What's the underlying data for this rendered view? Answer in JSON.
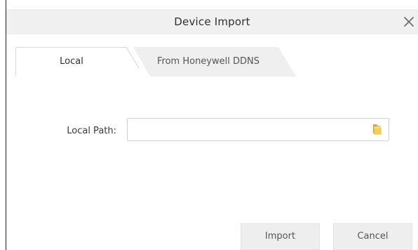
{
  "dialog": {
    "title": "Device Import",
    "close_icon": "close-icon"
  },
  "tabs": [
    {
      "label": "Local",
      "active": true
    },
    {
      "label": "From Honeywell DDNS",
      "active": false
    }
  ],
  "form": {
    "local_path_label": "Local Path:",
    "local_path_value": "",
    "browse_icon": "folder-icon"
  },
  "buttons": {
    "import_label": "Import",
    "cancel_label": "Cancel"
  },
  "colors": {
    "titlebar_bg": "#f0f0f0",
    "tab_inactive_bg": "#efefef",
    "button_bg": "#eeeeee",
    "folder_yellow": "#e8c24a"
  }
}
